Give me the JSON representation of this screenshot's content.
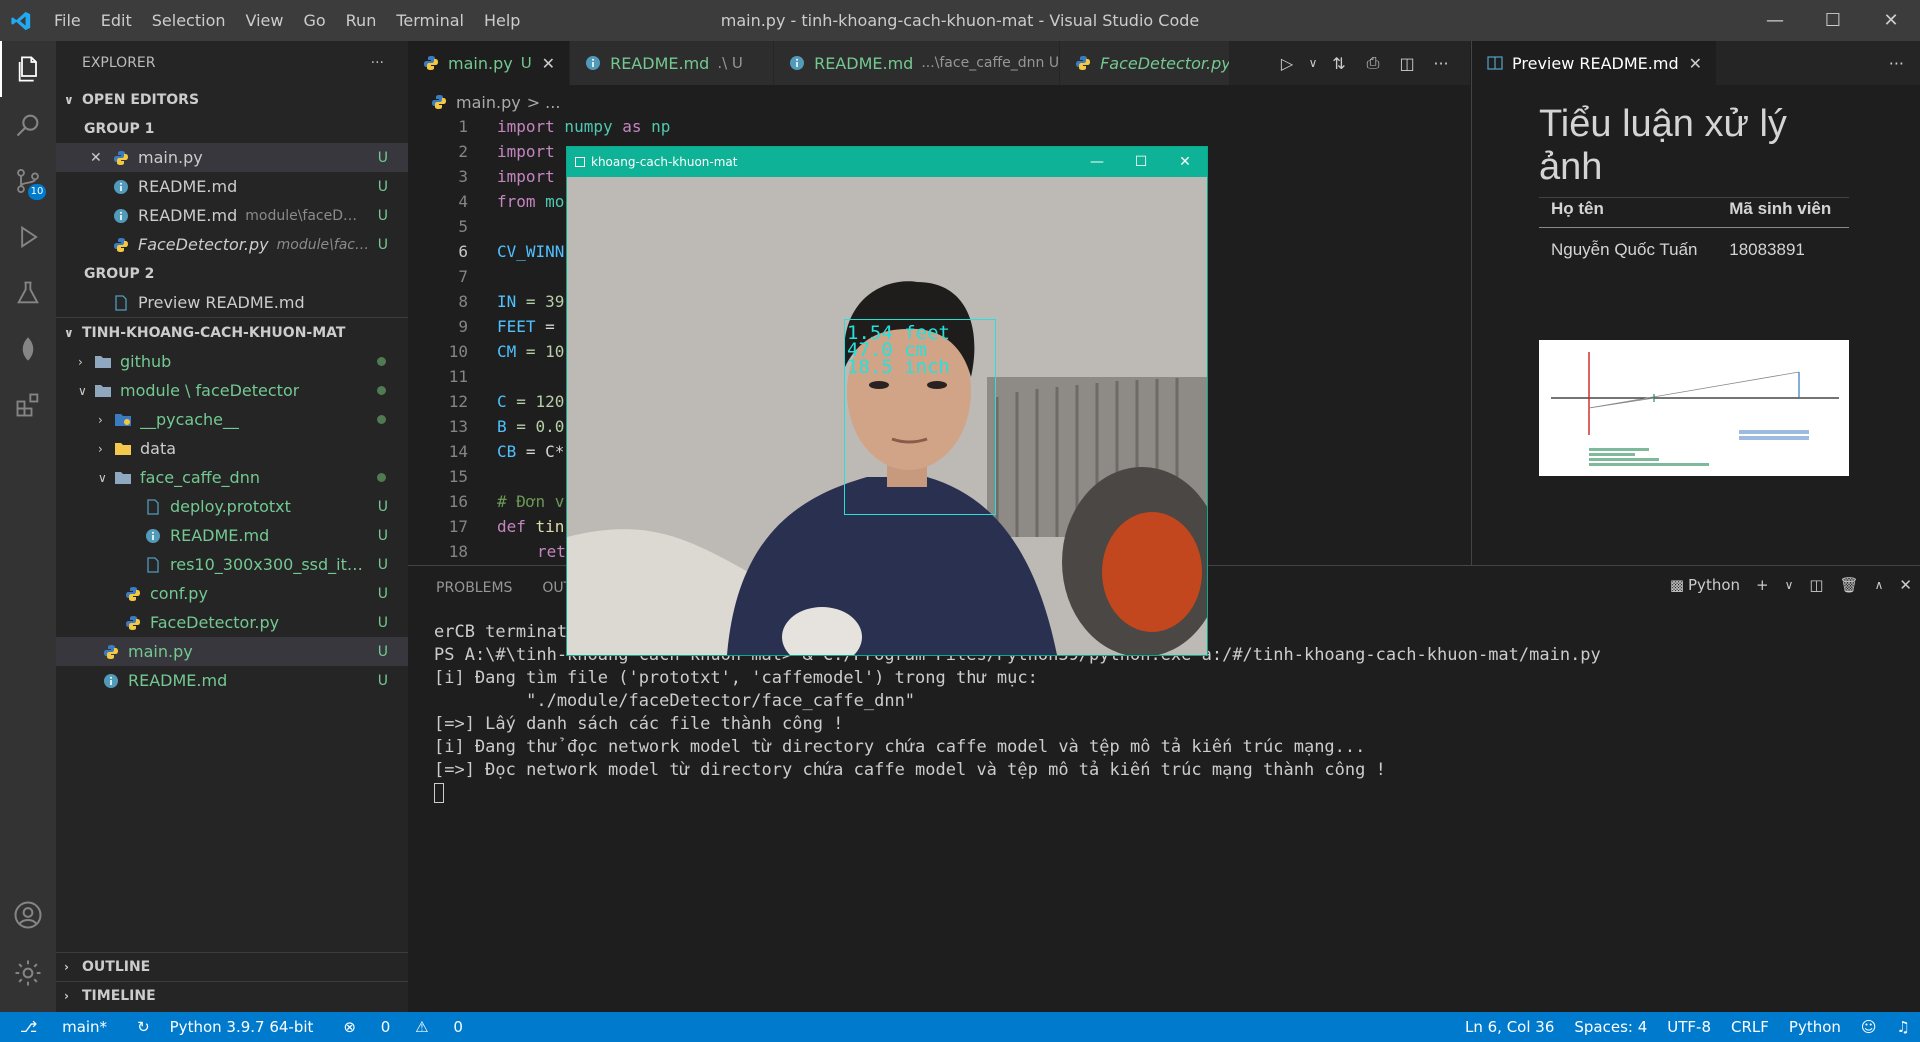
{
  "window": {
    "title": "main.py - tinh-khoang-cach-khuon-mat - Visual Studio Code"
  },
  "menu": [
    "File",
    "Edit",
    "Selection",
    "View",
    "Go",
    "Run",
    "Terminal",
    "Help"
  ],
  "activity_badge": "10",
  "explorer": {
    "title": "EXPLORER",
    "open_editors": "OPEN EDITORS",
    "group1": "GROUP 1",
    "group2": "GROUP 2",
    "g1_items": [
      {
        "label": "main.py",
        "desc": "",
        "badge": "U"
      },
      {
        "label": "README.md",
        "desc": "",
        "badge": "U"
      },
      {
        "label": "README.md",
        "desc": "module\\faceDet...",
        "badge": "U"
      },
      {
        "label": "FaceDetector.py",
        "desc": "module\\face...",
        "badge": "U"
      }
    ],
    "g2_items": [
      {
        "label": "Preview README.md"
      }
    ],
    "project": "TINH-KHOANG-CACH-KHUON-MAT",
    "tree": [
      {
        "label": "github",
        "badge": "",
        "dot": true
      },
      {
        "label": "module \\ faceDetector",
        "badge": "",
        "dot": true
      },
      {
        "label": "__pycache__",
        "badge": "",
        "dot": true
      },
      {
        "label": "data",
        "badge": ""
      },
      {
        "label": "face_caffe_dnn",
        "badge": "",
        "dot": true
      },
      {
        "label": "deploy.prototxt",
        "badge": "U"
      },
      {
        "label": "README.md",
        "badge": "U"
      },
      {
        "label": "res10_300x300_ssd_iter_...",
        "badge": "U"
      },
      {
        "label": "conf.py",
        "badge": "U"
      },
      {
        "label": "FaceDetector.py",
        "badge": "U"
      },
      {
        "label": "main.py",
        "badge": "U"
      },
      {
        "label": "README.md",
        "badge": "U"
      }
    ],
    "outline": "OUTLINE",
    "timeline": "TIMELINE"
  },
  "tabs": [
    {
      "label": "main.py",
      "mod": "U"
    },
    {
      "label": "README.md",
      "mod": ".\\ U"
    },
    {
      "label": "README.md",
      "mod": "...\\face_caffe_dnn  U"
    },
    {
      "label": "FaceDetector.py",
      "mod": "U"
    }
  ],
  "breadcrumb": {
    "file": "main.py",
    "rest": "> ..."
  },
  "code_lines": [
    "1",
    "2",
    "3",
    "4",
    "5",
    "6",
    "7",
    "8",
    "9",
    "10",
    "11",
    "12",
    "13",
    "14",
    "15",
    "16",
    "17",
    "18"
  ],
  "code": {
    "l1a": "import",
    "l1b": " numpy ",
    "l1c": "as",
    "l1d": " np",
    "l2": "import",
    "l3": "import",
    "l4a": "from",
    "l4b": " mo",
    "l6": "CV_WINN",
    "l8a": "IN",
    "l8b": " = 39",
    "l9a": "FEET",
    "l9b": " = ",
    "l10a": "CM",
    "l10b": " = 10",
    "l12a": "C",
    "l12b": " = 120",
    "l13a": "B",
    "l13b": " = 0.0",
    "l14a": "CB",
    "l14b": " = C*",
    "l16": "# Đơn v",
    "l17a": "def",
    "l17b": " tin",
    "l18": "ret"
  },
  "preview": {
    "tab": "Preview README.md",
    "h1": "Tiểu luận xử lý ảnh",
    "th1": "Họ tên",
    "th2": "Mã sinh viên",
    "td1": "Nguyễn Quốc Tuấn",
    "td2": "18083891"
  },
  "panel": {
    "tabs": [
      "PROBLEMS",
      "OUT"
    ],
    "shell": "Python",
    "lines": [
      "erCB terminat",
      "PS A:\\#\\tinh-khoang-cach-khuon-mat> & C:/Program Files/Python39/python.exe a:/#/tinh-khoang-cach-khuon-mat/main.py",
      "[i] Đang tìm file ('prototxt', 'caffemodel') trong thư mục:",
      "         \"./module/faceDetector/face_caffe_dnn\"",
      "[=>] Lấy danh sách các file thành công !",
      "[i] Đang thử đọc network model từ directory chứa caffe model và tệp mô tả kiến trúc mạng...",
      "[=>] Đọc network model từ directory chứa caffe model và tệp mô tả kiến trúc mạng thành công !"
    ]
  },
  "cv_window": {
    "title": "khoang-cach-khuon-mat",
    "feet": "1.54 feet",
    "cm": "47.0 cm",
    "inch": "18.5 inch"
  },
  "status": {
    "branch": "main*",
    "python": "Python 3.9.7 64-bit",
    "errors": "0",
    "warnings": "0",
    "position": "Ln 6, Col 36",
    "spaces": "Spaces: 4",
    "encoding": "UTF-8",
    "eol": "CRLF",
    "lang": "Python"
  }
}
